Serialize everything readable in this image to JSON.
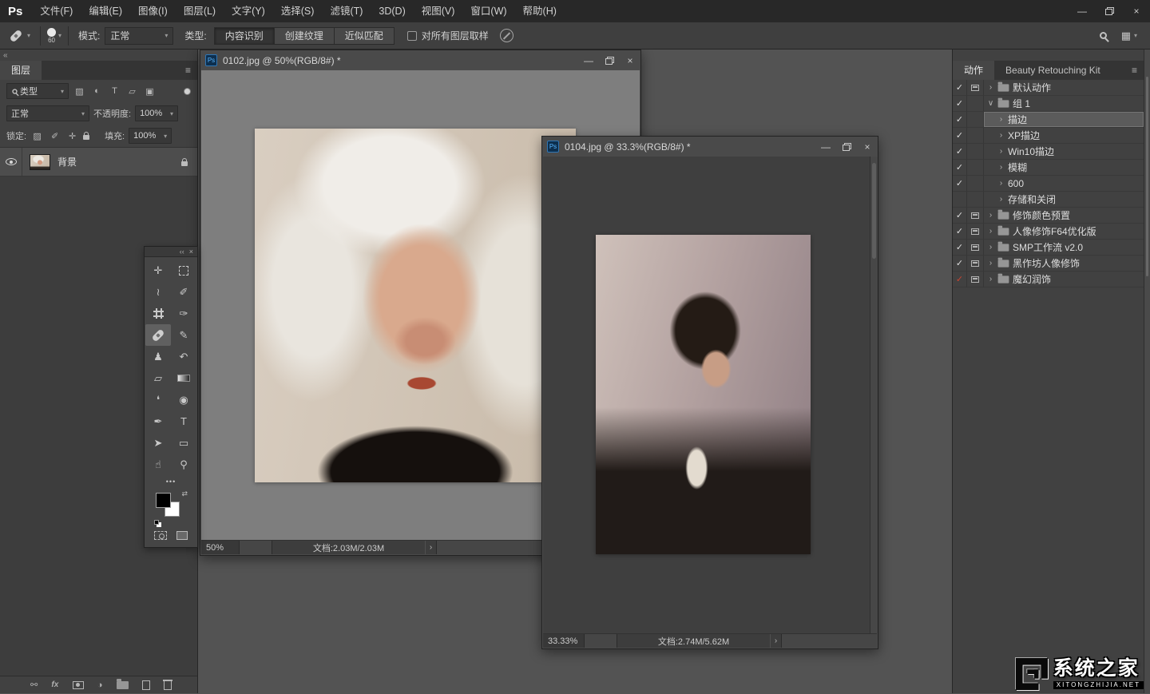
{
  "menubar": {
    "logo": "Ps",
    "items": [
      "文件(F)",
      "编辑(E)",
      "图像(I)",
      "图层(L)",
      "文字(Y)",
      "选择(S)",
      "滤镜(T)",
      "3D(D)",
      "视图(V)",
      "窗口(W)",
      "帮助(H)"
    ]
  },
  "options_bar": {
    "brush_size": "60",
    "mode_label": "模式:",
    "mode_value": "正常",
    "type_label": "类型:",
    "type_buttons": [
      "内容识别",
      "创建纹理",
      "近似匹配"
    ],
    "active_type_button": "内容识别",
    "sample_all_layers_label": "对所有图层取样"
  },
  "layers_panel": {
    "tab": "图层",
    "filter_label": "类型",
    "blend_mode": "正常",
    "opacity_label": "不透明度:",
    "opacity_value": "100%",
    "lock_label": "锁定:",
    "fill_label": "填充:",
    "fill_value": "100%",
    "layers": [
      {
        "name": "背景",
        "visible": true,
        "locked": true
      }
    ]
  },
  "documents": [
    {
      "title": "0102.jpg @ 50%(RGB/8#) *",
      "zoom": "50%",
      "doc_info": "文档:2.03M/2.03M"
    },
    {
      "title": "0104.jpg @ 33.3%(RGB/8#) *",
      "zoom": "33.33%",
      "doc_info": "文档:2.74M/5.62M"
    }
  ],
  "actions_panel": {
    "tabs": [
      "动作",
      "Beauty Retouching Kit"
    ],
    "active_tab": "动作",
    "items": [
      {
        "label": "默认动作",
        "type": "set",
        "checked": true,
        "dialog": true,
        "expanded": false
      },
      {
        "label": "组 1",
        "type": "set",
        "checked": true,
        "dialog": false,
        "expanded": true
      },
      {
        "label": "描边",
        "type": "action",
        "checked": true,
        "selected": true
      },
      {
        "label": "XP描边",
        "type": "action",
        "checked": true
      },
      {
        "label": "Win10描边",
        "type": "action",
        "checked": true
      },
      {
        "label": "模糊",
        "type": "action",
        "checked": true
      },
      {
        "label": "600",
        "type": "action",
        "checked": true
      },
      {
        "label": "存储和关闭",
        "type": "action",
        "checked": false
      },
      {
        "label": "修饰颜色预置",
        "type": "set",
        "checked": true,
        "dialog": true
      },
      {
        "label": "人像修饰F64优化版",
        "type": "set",
        "checked": true,
        "dialog": true
      },
      {
        "label": "SMP工作流 v2.0",
        "type": "set",
        "checked": true,
        "dialog": true
      },
      {
        "label": "黑作坊人像修饰",
        "type": "set",
        "checked": true,
        "dialog": true
      },
      {
        "label": "魔幻润饰",
        "type": "set",
        "checked": true,
        "check_color": "#cc4430",
        "dialog": true
      }
    ]
  },
  "watermark": {
    "title": "系统之家",
    "subtitle": "XITONGZHIJIA.NET"
  },
  "colors": {
    "foreground_swatch": "#000000",
    "background_swatch": "#ffffff",
    "red_check": "#cc4430",
    "ps_file_icon_blue": "#58b6ff",
    "workspace_background": "#535353"
  },
  "icons": {
    "collapse_left": "«",
    "collapse_double": "‹‹",
    "panel_menu": "≡",
    "caret": "▾",
    "check": "✓",
    "chevron_right": "›",
    "chevron_down": "∨",
    "close": "×",
    "minimize": "—",
    "ellipsis": "•••",
    "swap_colors": "⇄",
    "workspace_grid": "▦",
    "tools": {
      "move": "✛",
      "lasso": "≀",
      "quick_select": "✐",
      "eyedropper": "✑",
      "brush": "✎",
      "clone_stamp": "♟",
      "history_brush": "↶",
      "eraser": "▱",
      "blur": "❛",
      "dodge": "◉",
      "pen": "✒",
      "type": "T",
      "path_select": "➤",
      "rectangle": "▭",
      "hand": "☝",
      "zoom": "⚲"
    },
    "layer_filters": {
      "pixel": "▨",
      "adjustment": "◐",
      "type": "T",
      "shape": "▱",
      "smart_object": "▣"
    },
    "panel_footer": {
      "link": "⚯",
      "fx": "fx",
      "adjustment": "◑"
    }
  }
}
